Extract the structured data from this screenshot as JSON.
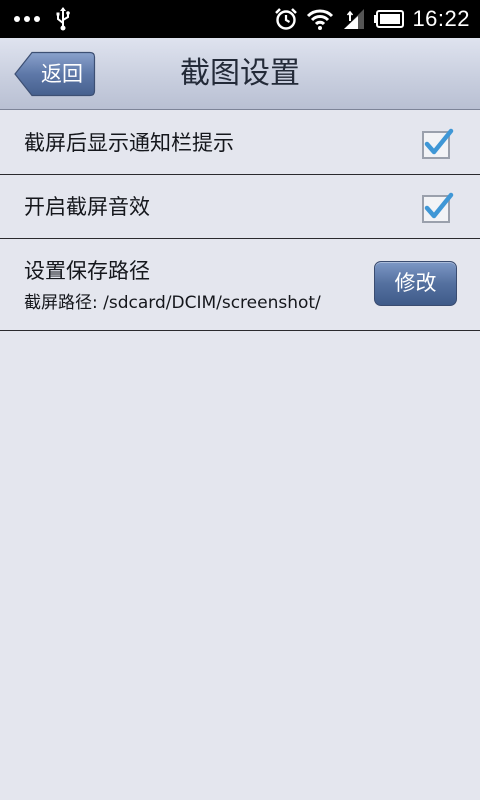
{
  "status_bar": {
    "time": "16:22",
    "icons": [
      "more-dots-icon",
      "usb-icon",
      "alarm-icon",
      "wifi-icon",
      "signal-icon",
      "battery-icon"
    ]
  },
  "header": {
    "back_label": "返回",
    "title": "截图设置"
  },
  "settings": {
    "items": [
      {
        "label": "截屏后显示通知栏提示",
        "checked": true
      },
      {
        "label": "开启截屏音效",
        "checked": true
      }
    ],
    "save_path": {
      "label": "设置保存路径",
      "path_text": "截屏路径: /sdcard/DCIM/screenshot/",
      "modify_label": "修改"
    }
  },
  "colors": {
    "check_mark": "#3f97d6",
    "button_blue": "#54709f",
    "background": "#e4e6ee"
  }
}
